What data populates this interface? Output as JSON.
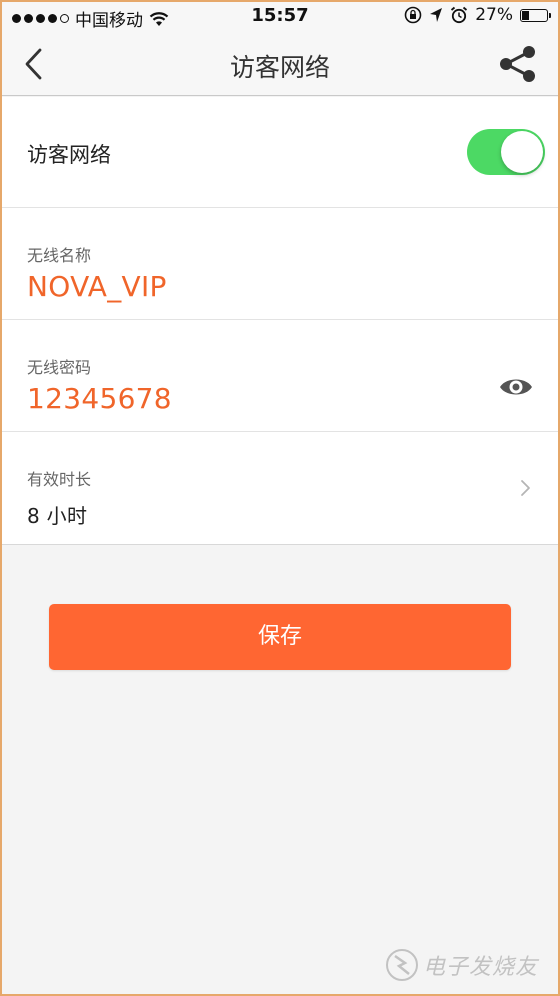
{
  "status_bar": {
    "carrier": "中国移动",
    "time": "15:57",
    "battery_percent": "27%",
    "battery_level": 0.27,
    "signal_bars_filled": 4,
    "signal_bars_total": 5,
    "icons": [
      "signal-dots-icon",
      "wifi-icon",
      "rotation-lock-icon",
      "location-arrow-icon",
      "alarm-icon",
      "battery-icon"
    ]
  },
  "nav": {
    "title": "访客网络",
    "back_icon": "chevron-left-icon",
    "share_icon": "share-icon"
  },
  "guest_network": {
    "toggle_label": "访客网络",
    "enabled": true,
    "toggle_color": "#4cd964"
  },
  "ssid": {
    "caption": "无线名称",
    "value": "NOVA_VIP"
  },
  "password": {
    "caption": "无线密码",
    "value": "12345678",
    "icon": "eye-icon"
  },
  "duration": {
    "caption": "有效时长",
    "value": "8 小时",
    "icon": "chevron-right-icon"
  },
  "save_button": {
    "label": "保存",
    "color": "#ff6632"
  },
  "accent_color": "#f0652a",
  "watermark": {
    "text": "电子发烧友"
  }
}
